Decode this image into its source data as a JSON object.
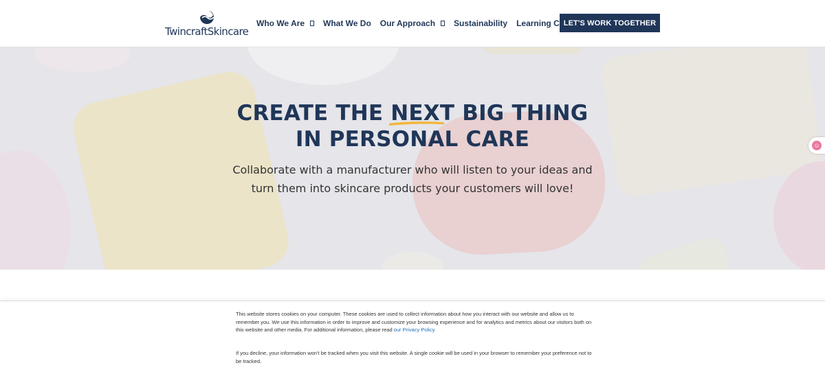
{
  "header": {
    "logo_text": "TwincraftSkincare",
    "nav": [
      {
        "label": "Who We Are",
        "has_dropdown": true
      },
      {
        "label": "What We Do",
        "has_dropdown": false
      },
      {
        "label": "Our Approach",
        "has_dropdown": true
      },
      {
        "label": "Sustainability",
        "has_dropdown": false
      },
      {
        "label": "Learning Center",
        "has_dropdown": true
      }
    ],
    "cta_label": "LET'S WORK TOGETHER"
  },
  "hero": {
    "title_part1": "CREATE THE ",
    "title_highlight": "NEXT BIG THING",
    "title_line2": "IN PERSONAL CARE",
    "subtitle": "Collaborate with a manufacturer who will listen to your ideas and turn them into skincare products your customers will love!"
  },
  "cookie": {
    "paragraph1": "This website stores cookies on your computer. These cookies are used to collect information about how you interact with our website and allow us to remember you. We use this information in order to improve and customize your browsing experience and for analytics and metrics about our visitors both on this website and other media. For additional information, please read ",
    "privacy_link": "our Privacy Policy.",
    "paragraph2": "If you decline, your information won't be tracked when you visit this website. A single cookie will be used in your browser to remember your preference not to be tracked."
  },
  "colors": {
    "brand_navy": "#1f3658",
    "highlight_yellow": "#f2b63c",
    "link_blue": "#1e6fb8"
  },
  "icons": {
    "logo_mark": "wave-circle-icon",
    "dropdown": "chevron-down-icon",
    "side_widget": "accessibility-icon"
  }
}
